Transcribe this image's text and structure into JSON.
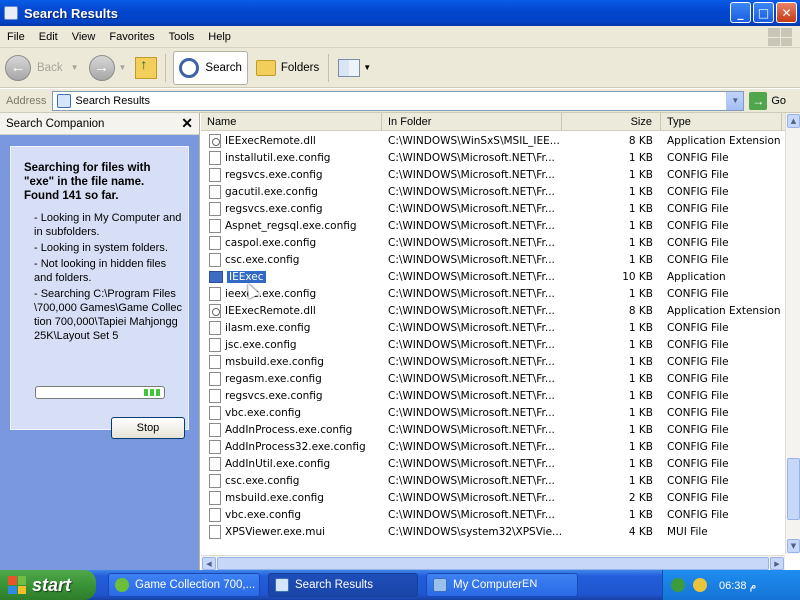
{
  "window": {
    "title": "Search Results"
  },
  "window_controls": {
    "minimize": "_",
    "maximize": "□",
    "close": "✕"
  },
  "menu": [
    "File",
    "Edit",
    "View",
    "Favorites",
    "Tools",
    "Help"
  ],
  "toolbar": {
    "back": "Back",
    "search": "Search",
    "folders": "Folders"
  },
  "address": {
    "label": "Address",
    "value": "Search Results",
    "go": "Go"
  },
  "search_companion": {
    "title": "Search Companion",
    "close": "✕",
    "headline": "Searching for files with \"exe\" in the file name. Found 141 so far.",
    "status": [
      "- Looking in My Computer and in subfolders.",
      "- Looking in system folders.",
      "- Not looking in hidden files and folders.",
      "- Searching C:\\Program Files\\700,000 Games\\Game Collection 700,000\\Tapiei Mahjongg 25K\\Layout Set 5"
    ],
    "stop": "Stop"
  },
  "columns": {
    "name": "Name",
    "folder": "In Folder",
    "size": "Size",
    "type": "Type"
  },
  "files": [
    {
      "name": "IEExecRemote.dll",
      "folder": "C:\\WINDOWS\\WinSxS\\MSIL_IEE...",
      "size": "8 KB",
      "type": "Application Extension",
      "icon": "dll"
    },
    {
      "name": "installutil.exe.config",
      "folder": "C:\\WINDOWS\\Microsoft.NET\\Fr...",
      "size": "1 KB",
      "type": "CONFIG File",
      "icon": "file"
    },
    {
      "name": "regsvcs.exe.config",
      "folder": "C:\\WINDOWS\\Microsoft.NET\\Fr...",
      "size": "1 KB",
      "type": "CONFIG File",
      "icon": "file"
    },
    {
      "name": "gacutil.exe.config",
      "folder": "C:\\WINDOWS\\Microsoft.NET\\Fr...",
      "size": "1 KB",
      "type": "CONFIG File",
      "icon": "file"
    },
    {
      "name": "regsvcs.exe.config",
      "folder": "C:\\WINDOWS\\Microsoft.NET\\Fr...",
      "size": "1 KB",
      "type": "CONFIG File",
      "icon": "file"
    },
    {
      "name": "Aspnet_regsql.exe.config",
      "folder": "C:\\WINDOWS\\Microsoft.NET\\Fr...",
      "size": "1 KB",
      "type": "CONFIG File",
      "icon": "file"
    },
    {
      "name": "caspol.exe.config",
      "folder": "C:\\WINDOWS\\Microsoft.NET\\Fr...",
      "size": "1 KB",
      "type": "CONFIG File",
      "icon": "file"
    },
    {
      "name": "csc.exe.config",
      "folder": "C:\\WINDOWS\\Microsoft.NET\\Fr...",
      "size": "1 KB",
      "type": "CONFIG File",
      "icon": "file"
    },
    {
      "name": "IEExec",
      "folder": "C:\\WINDOWS\\Microsoft.NET\\Fr...",
      "size": "10 KB",
      "type": "Application",
      "icon": "exe",
      "selected": true
    },
    {
      "name": "ieexec.exe.config",
      "folder": "C:\\WINDOWS\\Microsoft.NET\\Fr...",
      "size": "1 KB",
      "type": "CONFIG File",
      "icon": "file"
    },
    {
      "name": "IEExecRemote.dll",
      "folder": "C:\\WINDOWS\\Microsoft.NET\\Fr...",
      "size": "8 KB",
      "type": "Application Extension",
      "icon": "dll"
    },
    {
      "name": "ilasm.exe.config",
      "folder": "C:\\WINDOWS\\Microsoft.NET\\Fr...",
      "size": "1 KB",
      "type": "CONFIG File",
      "icon": "file"
    },
    {
      "name": "jsc.exe.config",
      "folder": "C:\\WINDOWS\\Microsoft.NET\\Fr...",
      "size": "1 KB",
      "type": "CONFIG File",
      "icon": "file"
    },
    {
      "name": "msbuild.exe.config",
      "folder": "C:\\WINDOWS\\Microsoft.NET\\Fr...",
      "size": "1 KB",
      "type": "CONFIG File",
      "icon": "file"
    },
    {
      "name": "regasm.exe.config",
      "folder": "C:\\WINDOWS\\Microsoft.NET\\Fr...",
      "size": "1 KB",
      "type": "CONFIG File",
      "icon": "file"
    },
    {
      "name": "regsvcs.exe.config",
      "folder": "C:\\WINDOWS\\Microsoft.NET\\Fr...",
      "size": "1 KB",
      "type": "CONFIG File",
      "icon": "file"
    },
    {
      "name": "vbc.exe.config",
      "folder": "C:\\WINDOWS\\Microsoft.NET\\Fr...",
      "size": "1 KB",
      "type": "CONFIG File",
      "icon": "file"
    },
    {
      "name": "AddInProcess.exe.config",
      "folder": "C:\\WINDOWS\\Microsoft.NET\\Fr...",
      "size": "1 KB",
      "type": "CONFIG File",
      "icon": "file"
    },
    {
      "name": "AddInProcess32.exe.config",
      "folder": "C:\\WINDOWS\\Microsoft.NET\\Fr...",
      "size": "1 KB",
      "type": "CONFIG File",
      "icon": "file"
    },
    {
      "name": "AddInUtil.exe.config",
      "folder": "C:\\WINDOWS\\Microsoft.NET\\Fr...",
      "size": "1 KB",
      "type": "CONFIG File",
      "icon": "file"
    },
    {
      "name": "csc.exe.config",
      "folder": "C:\\WINDOWS\\Microsoft.NET\\Fr...",
      "size": "1 KB",
      "type": "CONFIG File",
      "icon": "file"
    },
    {
      "name": "msbuild.exe.config",
      "folder": "C:\\WINDOWS\\Microsoft.NET\\Fr...",
      "size": "2 KB",
      "type": "CONFIG File",
      "icon": "file"
    },
    {
      "name": "vbc.exe.config",
      "folder": "C:\\WINDOWS\\Microsoft.NET\\Fr...",
      "size": "1 KB",
      "type": "CONFIG File",
      "icon": "file"
    },
    {
      "name": "XPSViewer.exe.mui",
      "folder": "C:\\WINDOWS\\system32\\XPSVie...",
      "size": "4 KB",
      "type": "MUI File",
      "icon": "file"
    }
  ],
  "taskbar": {
    "start": "start",
    "tasks": [
      {
        "label": "Game Collection 700,...",
        "active": false
      },
      {
        "label": "Search Results",
        "active": true
      },
      {
        "label": "My Computer",
        "active": false
      }
    ],
    "language": "EN",
    "clock": "06:38 م"
  },
  "colors": {
    "selection": "#316ac5",
    "taskbar": "#245edb",
    "titlebar": "#0347d0",
    "sidebar": "#7a98de"
  }
}
